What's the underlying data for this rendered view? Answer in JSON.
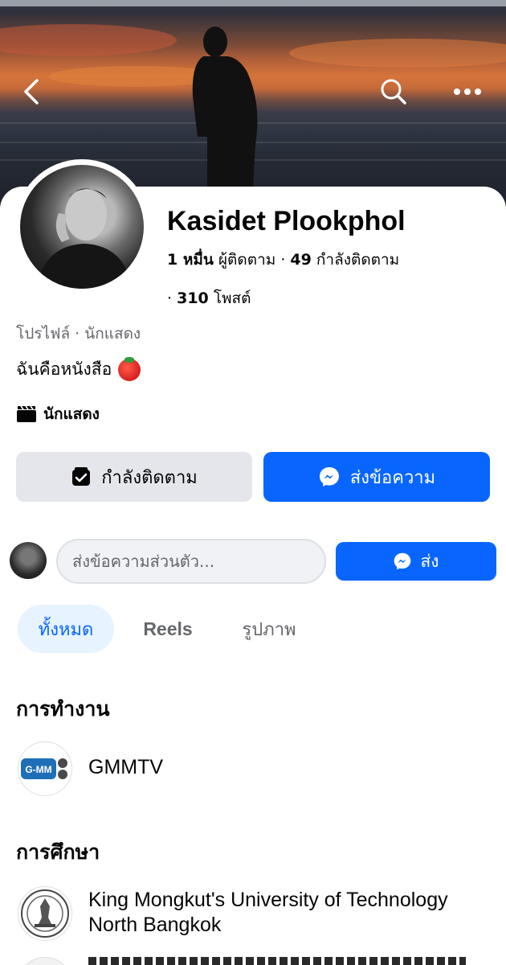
{
  "colors": {
    "accent": "#0866ff",
    "accent_light": "#e7f3ff",
    "button_gray": "#e4e6eb",
    "secondary_text": "#65676b"
  },
  "header": {
    "back_icon": "chevron-left-icon",
    "search_icon": "search-icon",
    "more_icon": "more-horizontal-icon"
  },
  "profile": {
    "name": "Kasidet Plookphol",
    "followers_count": "1 หมื่น",
    "followers_label": "ผู้ติดตาม",
    "following_count": "49",
    "following_label": "กำลังติดตาม",
    "posts_count": "310",
    "posts_label": "โพสต์",
    "separator": "·",
    "category": "โปรไฟล์ · นักแสดง",
    "bio": "ฉันคือหนังสือ",
    "bio_emoji": "tomato",
    "job": "นักแสดง",
    "job_icon": "clapperboard-icon"
  },
  "actions": {
    "following_label": "กำลังติดตาม",
    "message_label": "ส่งข้อความ"
  },
  "composer": {
    "placeholder": "ส่งข้อความส่วนตัว...",
    "send_label": "ส่ง"
  },
  "tabs": [
    {
      "label": "ทั้งหมด",
      "active": true
    },
    {
      "label": "Reels",
      "active": false
    },
    {
      "label": "รูปภาพ",
      "active": false
    }
  ],
  "work": {
    "title": "การทำงาน",
    "items": [
      {
        "name": "GMMTV",
        "logo_text": "G-MM"
      }
    ]
  },
  "education": {
    "title": "การศึกษา",
    "items": [
      {
        "name_line1": "King Mongkut's University of Technology",
        "name_line2": "North Bangkok"
      }
    ]
  }
}
